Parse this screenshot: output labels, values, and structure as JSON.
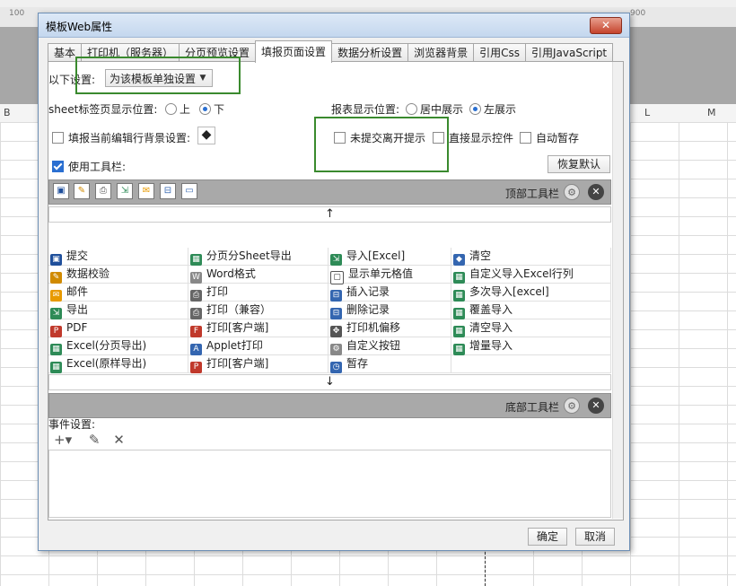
{
  "spreadsheet": {
    "ruler": [
      "100",
      "900"
    ],
    "columns": [
      "B",
      "L",
      "M"
    ]
  },
  "dialog": {
    "title": "模板Web属性",
    "close_icon": "close-icon",
    "tabs": [
      "基本",
      "打印机（服务器）",
      "分页预览设置",
      "填报页面设置",
      "数据分析设置",
      "浏览器背景",
      "引用Css",
      "引用JavaScript"
    ],
    "active_tab": "填报页面设置",
    "settings": {
      "label": "以下设置:",
      "select_value": "为该模板单独设置"
    },
    "sheet_tab": {
      "label": "sheet标签页显示位置:",
      "options": [
        "上",
        "下"
      ],
      "selected": "下"
    },
    "report_pos": {
      "label": "报表显示位置:",
      "options": [
        "居中展示",
        "左展示"
      ],
      "selected": "左展示"
    },
    "checkboxes": {
      "bg_fill": "填报当前编辑行背景设置:",
      "unsubmitted": "未提交离开提示",
      "direct_show": "直接显示控件",
      "autosave": "自动暂存",
      "use_toolbar": "使用工具栏:"
    },
    "restore_default": "恢复默认",
    "top_toolbar_label": "顶部工具栏",
    "bottom_toolbar_label": "底部工具栏",
    "toolbar_items": [
      [
        "提交",
        "分页分Sheet导出",
        "导入[Excel]",
        "清空"
      ],
      [
        "数据校验",
        "Word格式",
        "显示单元格值",
        "自定义导入Excel行列"
      ],
      [
        "邮件",
        "打印",
        "插入记录",
        "多次导入[excel]"
      ],
      [
        "导出",
        "打印（兼容）",
        "删除记录",
        "覆盖导入"
      ],
      [
        "PDF",
        "打印[客户端]",
        "打印机偏移",
        "清空导入"
      ],
      [
        "Excel(分页导出)",
        "Applet打印",
        "自定义按钮",
        "增量导入"
      ],
      [
        "Excel(原样导出)",
        "打印[客户端]",
        "暂存",
        ""
      ]
    ],
    "event_label": "事件设置:",
    "ok": "确定",
    "cancel": "取消",
    "colors": {
      "accent": "#2a6fd1",
      "highlight_box": "#3a8a2e"
    }
  }
}
